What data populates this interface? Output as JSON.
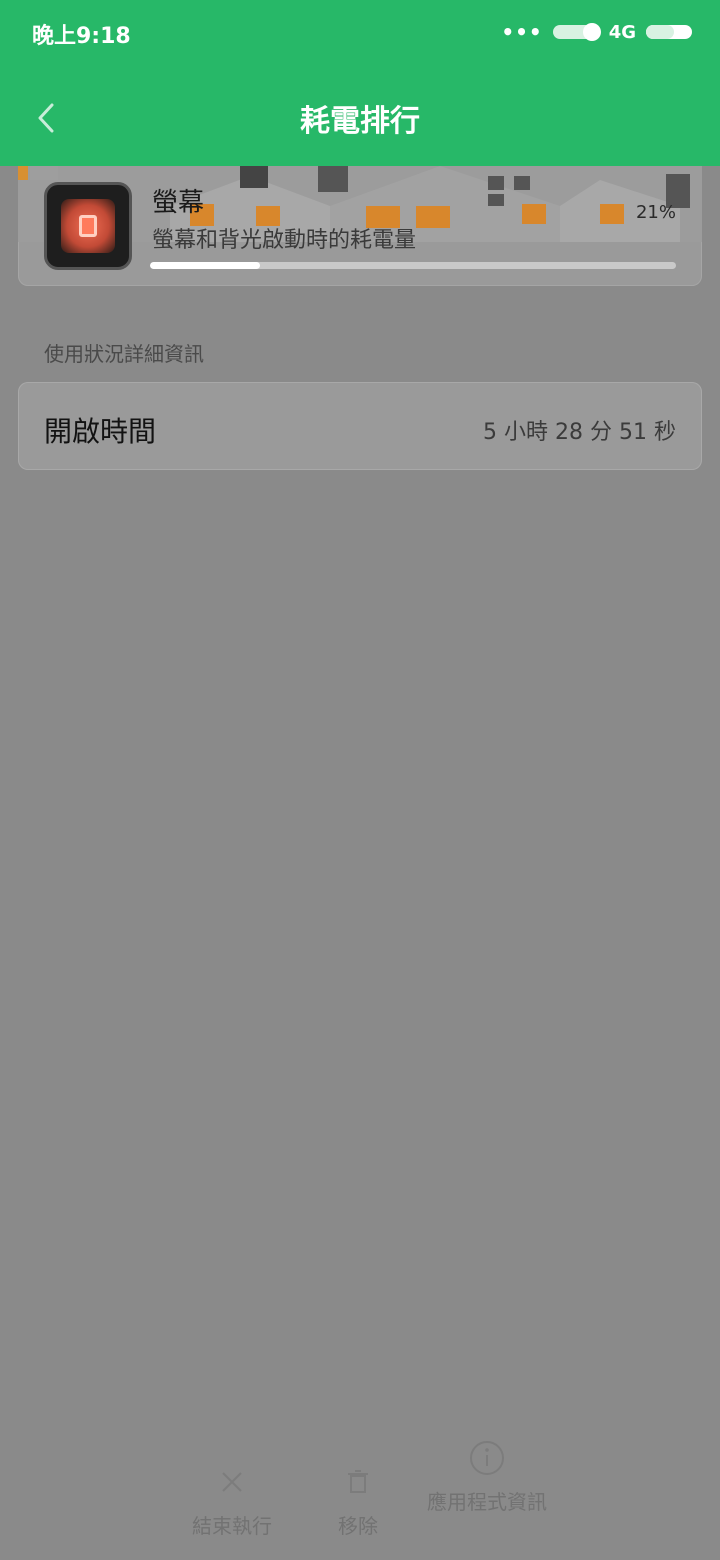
{
  "status": {
    "time": "晚上9:18",
    "network": "4G",
    "icons": [
      "more-dots-icon",
      "toggle-icon",
      "signal-4g-icon",
      "battery-icon"
    ]
  },
  "header": {
    "title": "耗電排行",
    "back_icon": "chevron-left-icon"
  },
  "item": {
    "name": "螢幕",
    "description": "螢幕和背光啟動時的耗電量",
    "percent_text": "21%",
    "progress": 0.21,
    "icon": "screen-icon"
  },
  "section": {
    "label": "使用狀況詳細資訊"
  },
  "detail": {
    "label": "開啟時間",
    "value": "5 小時 28 分 51 秒"
  },
  "actions": {
    "stop": "結束執行",
    "remove": "移除",
    "app_info": "應用程式資訊"
  },
  "colors": {
    "accent": "#27b868",
    "overlay": "#8a8a8a"
  }
}
